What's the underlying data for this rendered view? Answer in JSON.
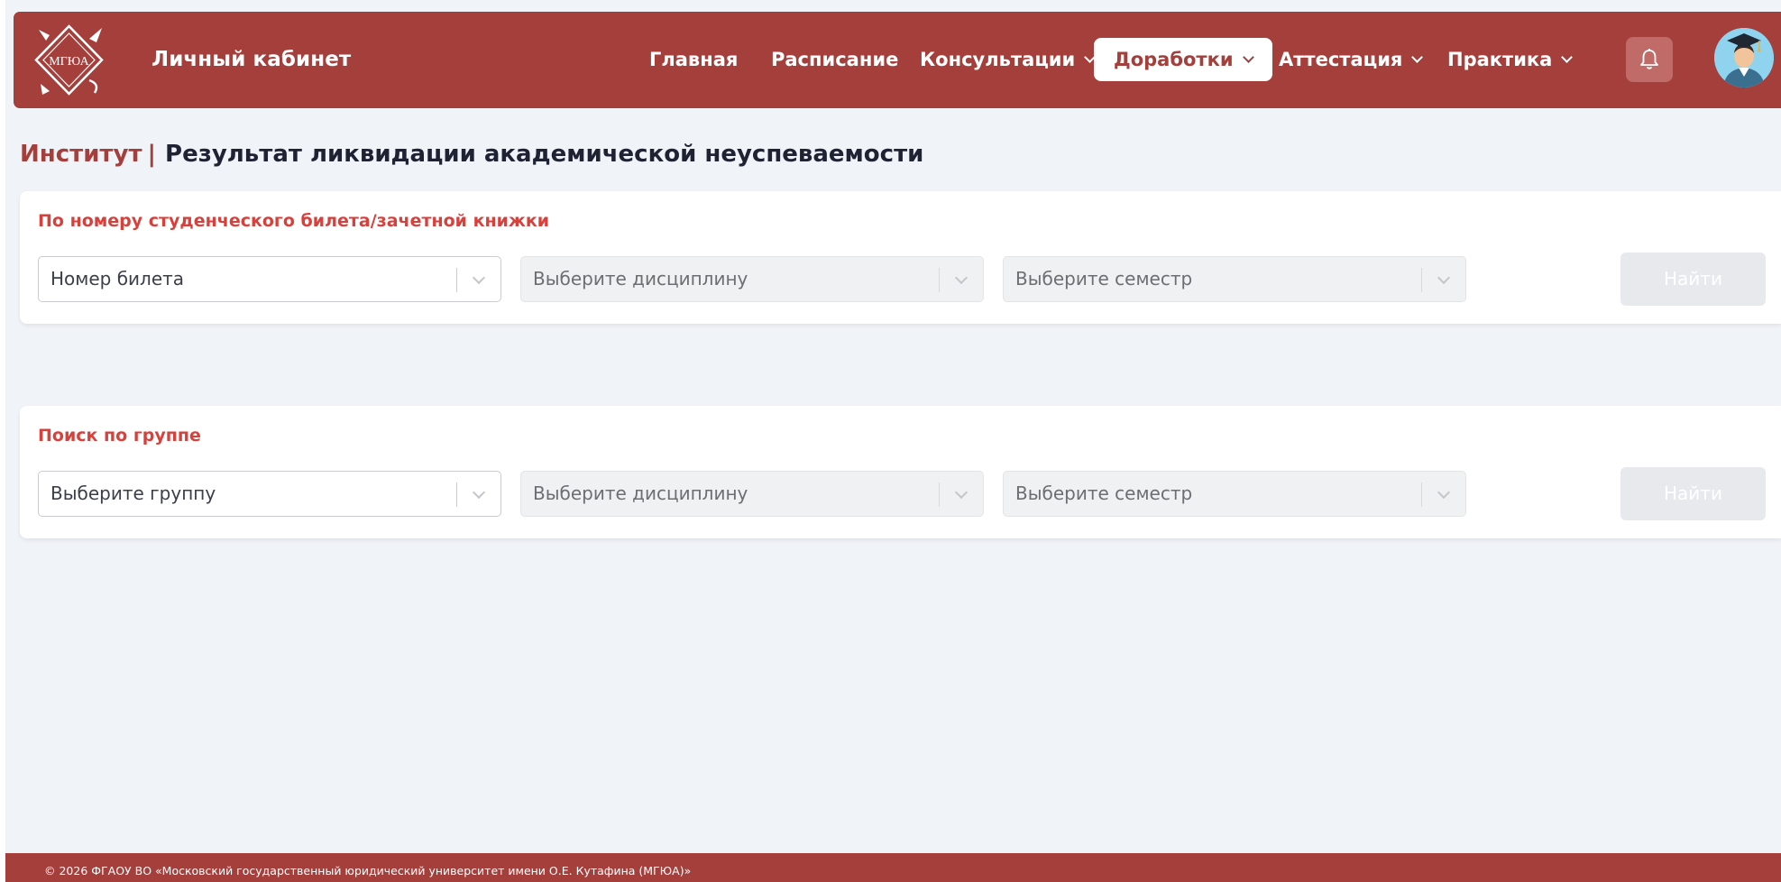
{
  "header": {
    "logo_text": "МГЮА",
    "brand_title": "Личный кабинет",
    "nav": [
      {
        "label": "Главная",
        "has_dropdown": false,
        "active": false
      },
      {
        "label": "Расписание",
        "has_dropdown": false,
        "active": false
      },
      {
        "label": "Консультации",
        "has_dropdown": true,
        "active": false
      },
      {
        "label": "Доработки",
        "has_dropdown": true,
        "active": true
      },
      {
        "label": "Аттестация",
        "has_dropdown": true,
        "active": false
      },
      {
        "label": "Практика",
        "has_dropdown": true,
        "active": false
      }
    ],
    "bell_icon": "bell-icon",
    "avatar_icon": "graduate-avatar"
  },
  "page": {
    "breadcrumb": "Институт",
    "separator": "|",
    "title": "Результат ликвидации академической неуспеваемости"
  },
  "search_by_ticket": {
    "label": "По номеру студенческого билета/зачетной книжки",
    "ticket_placeholder": "Номер билета",
    "discipline_placeholder": "Выберите дисциплину",
    "semester_placeholder": "Выберите семестр",
    "find_label": "Найти"
  },
  "search_by_group": {
    "label": "Поиск по группе",
    "group_placeholder": "Выберите группу",
    "discipline_placeholder": "Выберите дисциплину",
    "semester_placeholder": "Выберите семестр",
    "find_label": "Найти"
  },
  "footer": {
    "copyright": "© 2026 ФГАОУ ВО «Московский государственный юридический университет имени О.Е. Кутафина (МГЮА)»"
  },
  "colors": {
    "brand": "#a43f3c",
    "accent_label": "#d8403c",
    "background": "#f0f3f8"
  }
}
